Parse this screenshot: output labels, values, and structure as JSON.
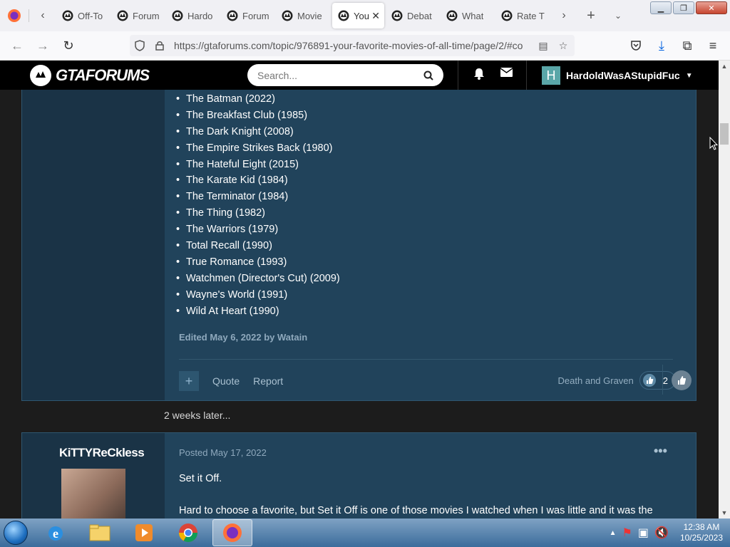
{
  "browser": {
    "tabs": [
      {
        "title": "Off-To",
        "active": false
      },
      {
        "title": "Forum",
        "active": false
      },
      {
        "title": "Hardo",
        "active": false
      },
      {
        "title": "Forum",
        "active": false
      },
      {
        "title": "Movie",
        "active": false
      },
      {
        "title": "You",
        "active": true
      },
      {
        "title": "Debat",
        "active": false
      },
      {
        "title": "What",
        "active": false
      },
      {
        "title": "Rate T",
        "active": false
      }
    ],
    "url": "https://gtaforums.com/topic/976891-your-favorite-movies-of-all-time/page/2/#co"
  },
  "site": {
    "logo_text": "GTAFORUMS",
    "search_placeholder": "Search...",
    "username": "HardoldWasAStupidFuc",
    "user_initial": "H"
  },
  "post1": {
    "movies": [
      "The Batman (2022)",
      "The Breakfast Club (1985)",
      "The Dark Knight (2008)",
      "The Empire Strikes Back (1980)",
      "The Hateful Eight (2015)",
      "The Karate Kid (1984)",
      "The Terminator (1984)",
      "The Thing (1982)",
      "The Warriors (1979)",
      "Total Recall (1990)",
      "True Romance (1993)",
      "Watchmen (Director's Cut) (2009)",
      "Wayne's World (1991)",
      "Wild At Heart (1990)"
    ],
    "edited": "Edited May 6, 2022 by Watain",
    "quote_label": "Quote",
    "report_label": "Report",
    "reaction_users": "Death and Graven",
    "reaction_count": "2"
  },
  "time_gap": "2 weeks later...",
  "post2": {
    "author": "KiTTYReCkless",
    "posted": "Posted May 17, 2022",
    "line1": "Set it Off.",
    "line2": "Hard to choose a favorite, but Set it Off is one of those movies I watched when I was little  and it was the"
  },
  "taskbar": {
    "time": "12:38 AM",
    "date": "10/25/2023"
  },
  "colors": {
    "post_bg": "#21435b",
    "author_bg": "#1a3346",
    "header_bg": "#000000",
    "page_bg": "#1c1c1c"
  }
}
